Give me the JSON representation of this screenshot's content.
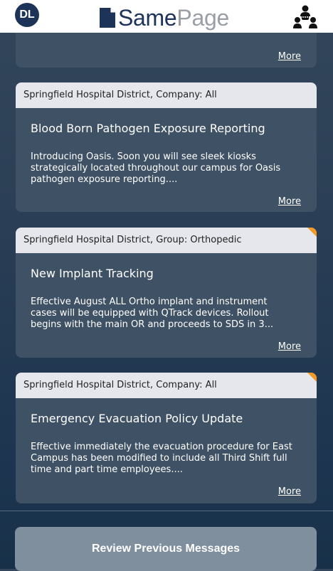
{
  "header": {
    "avatar_initials": "DL",
    "logo_part1": "Same",
    "logo_part2": "Page",
    "logo_icon": "document-icon",
    "right_icon": "people-network-icon",
    "brand_color": "#1e3358",
    "logo_grey": "#9a9fa6"
  },
  "cards": [
    {
      "more": "More"
    },
    {
      "header": "Springfield Hospital District, Company: All",
      "title": "Blood Born Pathogen Exposure Reporting",
      "body_lines": [
        "Introducing Oasis.  Soon you will see sleek kiosks",
        "strategically located throughout our campus for Oasis",
        "pathogen exposure reporting...."
      ],
      "more": "More",
      "flagged": false
    },
    {
      "header": "Springfield Hospital District, Group: Orthopedic",
      "title": "New Implant Tracking",
      "body_lines": [
        "Effective August ALL Ortho implant and instrument",
        "cases will be equipped with QTrack devices.  Rollout",
        "begins with the main OR and proceeds to SDS in 3..."
      ],
      "more": "More",
      "flagged": true
    },
    {
      "header": "Springfield Hospital District, Company: All",
      "title": "Emergency Evacuation Policy Update",
      "body_lines": [
        "Effective immediately the evacuation procedure for East",
        "Campus has been modified to include all Third Shift full",
        "time and part time employees...."
      ],
      "more": "More",
      "flagged": true
    }
  ],
  "review_button": "Review Previous Messages",
  "colors": {
    "card_bg": "#3f5164",
    "card_header_bg": "#e5e7ec",
    "flag": "#f39a24",
    "button_bg": "#7f8f9d"
  }
}
